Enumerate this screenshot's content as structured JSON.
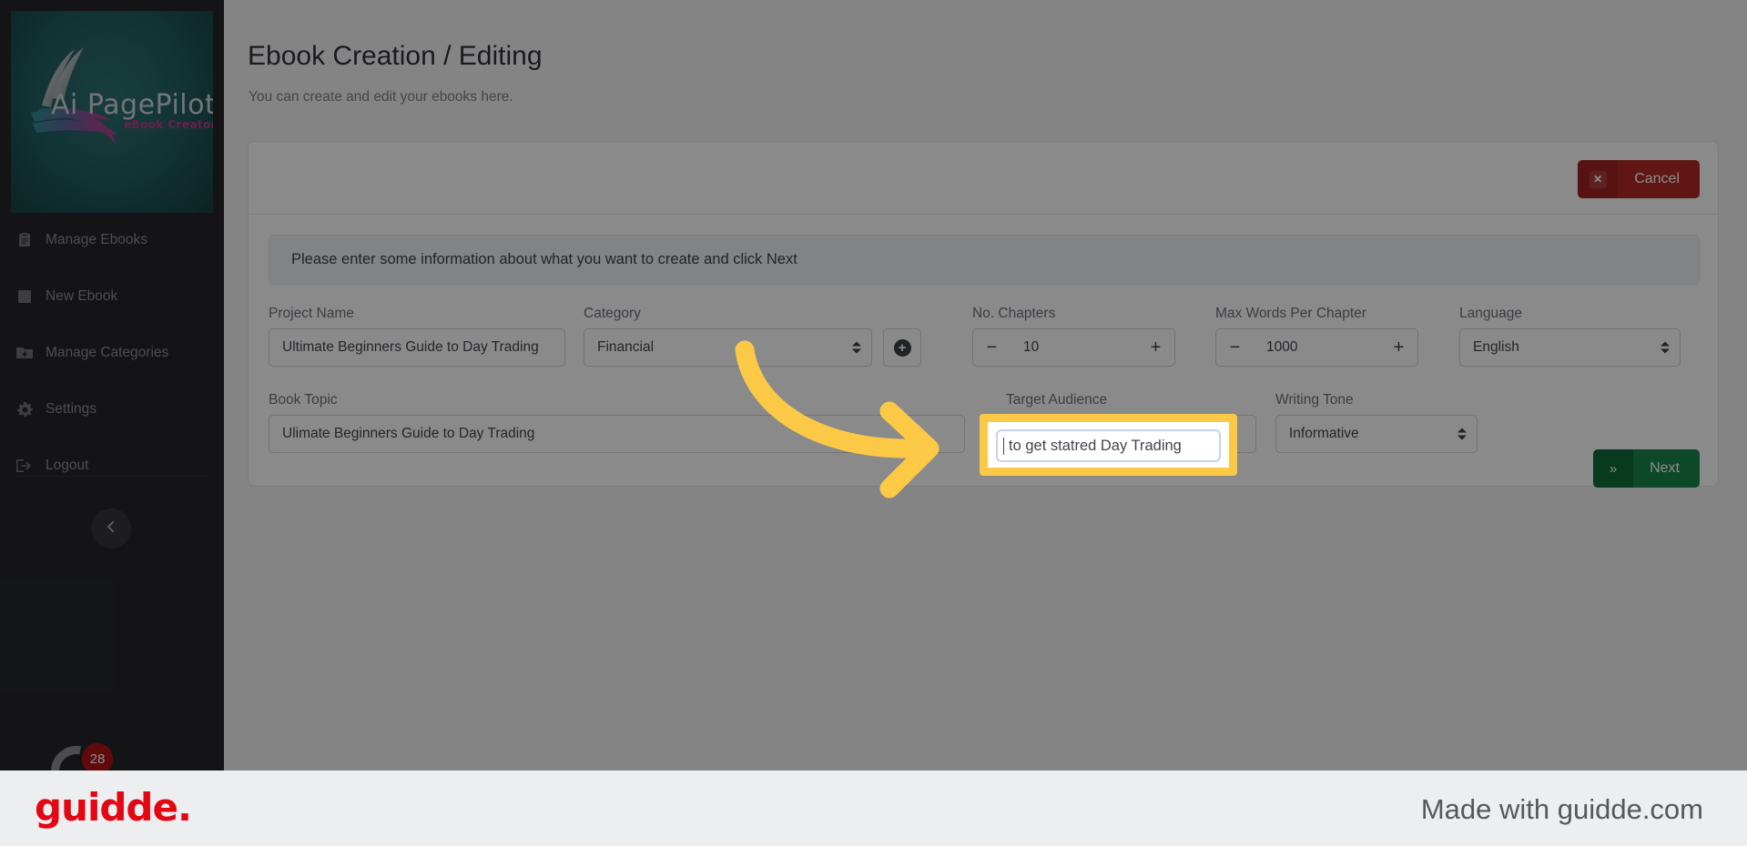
{
  "app": {
    "logo": {
      "wordmark": "Ai PagePilot",
      "subtitle": "eBook Creator.",
      "badge_count": "28"
    }
  },
  "sidebar": {
    "items": [
      {
        "label": "Manage Ebooks",
        "icon": "clipboard-icon"
      },
      {
        "label": "New Ebook",
        "icon": "book-icon"
      },
      {
        "label": "Manage Categories",
        "icon": "folder-plus-icon"
      },
      {
        "label": "Settings",
        "icon": "gear-icon"
      },
      {
        "label": "Logout",
        "icon": "logout-icon"
      }
    ],
    "collapse_icon": "chevron-left-icon"
  },
  "header": {
    "title": "Ebook Creation / Editing",
    "subtitle": "You can create and edit your ebooks here."
  },
  "card": {
    "cancel_button": {
      "label": "Cancel",
      "icon": "close-icon"
    },
    "notice": "Please enter some information about what you want to create and click Next",
    "next_button": {
      "label": "Next",
      "icon": "double-chevron-right-icon"
    },
    "fields": {
      "project_name": {
        "label": "Project Name",
        "value": "Ultimate Beginners Guide to Day Trading"
      },
      "category": {
        "label": "Category",
        "value": "Financial",
        "add_icon": "plus-circle-icon"
      },
      "no_chapters": {
        "label": "No. Chapters",
        "value": "10",
        "minus": "−",
        "plus": "+"
      },
      "max_words": {
        "label": "Max Words Per Chapter",
        "value": "1000",
        "minus": "−",
        "plus": "+"
      },
      "language": {
        "label": "Language",
        "value": "English"
      },
      "book_topic": {
        "label": "Book Topic",
        "value": "Ulimate Beginners Guide to Day Trading"
      },
      "target_audience": {
        "label": "Target Audience",
        "value": "to get statred Day Trading"
      },
      "writing_tone": {
        "label": "Writing Tone",
        "value": "Informative"
      }
    }
  },
  "footer": {
    "brand": "guidde.",
    "made_with": "Made with guidde.com"
  },
  "colors": {
    "sidebar_bg": "#25262b",
    "highlight": "#fcc946",
    "cancel_red": "#b02a25",
    "next_green": "#18844a",
    "guidde_red": "#e30613"
  }
}
